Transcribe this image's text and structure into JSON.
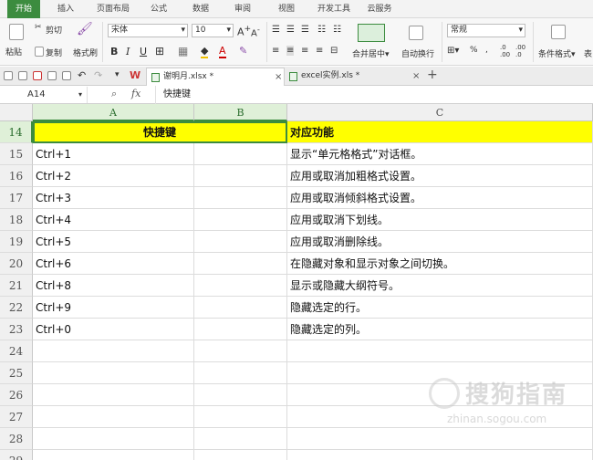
{
  "ribbon_tabs": [
    {
      "label": "开始",
      "active": true
    },
    {
      "label": "插入"
    },
    {
      "label": "页面布局"
    },
    {
      "label": "公式"
    },
    {
      "label": "数据"
    },
    {
      "label": "审阅"
    },
    {
      "label": "视图"
    },
    {
      "label": "开发工具"
    },
    {
      "label": "云服务"
    }
  ],
  "toolbar": {
    "paste_label": "粘贴",
    "cut_label": "剪切",
    "copy_label": "复制",
    "format_painter_label": "格式刷",
    "font_name": "宋体",
    "font_size": "10",
    "bold_label": "B",
    "italic_label": "I",
    "underline_label": "U",
    "merge_center_label": "合并居中",
    "auto_wrap_label": "自动换行",
    "number_format": "常规",
    "percent_label": "%",
    "cond_format_label": "条件格式",
    "table_style_label": "表",
    "increase_font_label": "A",
    "decrease_font_label": "A"
  },
  "doc_tabs": [
    {
      "label": "谢明月.xlsx *",
      "active": true
    },
    {
      "label": "excel实例.xls *"
    }
  ],
  "formula_bar": {
    "name_box": "A14",
    "fx_label": "fx",
    "content": "快捷键"
  },
  "columns": [
    "A",
    "B",
    "C"
  ],
  "rows": [
    {
      "num": "14",
      "a": "快捷键",
      "c": "对应功能",
      "header": true
    },
    {
      "num": "15",
      "a": "Ctrl+1",
      "c": "显示“单元格格式”对话框。"
    },
    {
      "num": "16",
      "a": "Ctrl+2",
      "c": "应用或取消加粗格式设置。"
    },
    {
      "num": "17",
      "a": "Ctrl+3",
      "c": "应用或取消倾斜格式设置。"
    },
    {
      "num": "18",
      "a": "Ctrl+4",
      "c": "应用或取消下划线。"
    },
    {
      "num": "19",
      "a": "Ctrl+5",
      "c": "应用或取消删除线。"
    },
    {
      "num": "20",
      "a": "Ctrl+6",
      "c": "在隐藏对象和显示对象之间切换。"
    },
    {
      "num": "21",
      "a": "Ctrl+8",
      "c": "显示或隐藏大纲符号。"
    },
    {
      "num": "22",
      "a": "Ctrl+9",
      "c": "隐藏选定的行。"
    },
    {
      "num": "23",
      "a": "Ctrl+0",
      "c": "隐藏选定的列。"
    },
    {
      "num": "24",
      "a": "",
      "c": ""
    },
    {
      "num": "25",
      "a": "",
      "c": ""
    },
    {
      "num": "26",
      "a": "",
      "c": ""
    },
    {
      "num": "27",
      "a": "",
      "c": ""
    },
    {
      "num": "28",
      "a": "",
      "c": ""
    },
    {
      "num": "29",
      "a": "",
      "c": ""
    }
  ],
  "watermark": {
    "text": "搜狗指南",
    "sub": "zhinan.sogou.com"
  },
  "colors": {
    "accent": "#3c8c3f",
    "header_fill": "#ffff00"
  }
}
